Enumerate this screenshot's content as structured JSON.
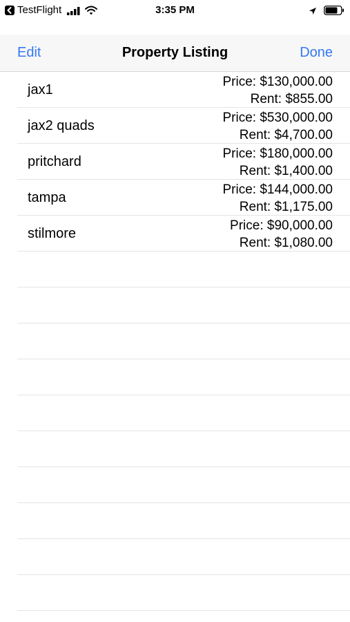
{
  "status_bar": {
    "back_app": "TestFlight",
    "time": "3:35 PM",
    "icons": [
      "back-arrow-icon",
      "signal-bars-icon",
      "wifi-icon",
      "location-arrow-icon",
      "battery-icon"
    ]
  },
  "nav": {
    "left_label": "Edit",
    "title": "Property Listing",
    "right_label": "Done",
    "accent_color": "#3478f6"
  },
  "properties": [
    {
      "name": "jax1",
      "price": "Price: $130,000.00",
      "rent": "Rent: $855.00"
    },
    {
      "name": "jax2 quads",
      "price": "Price: $530,000.00",
      "rent": "Rent: $4,700.00"
    },
    {
      "name": "pritchard",
      "price": "Price: $180,000.00",
      "rent": "Rent: $1,400.00"
    },
    {
      "name": "tampa",
      "price": "Price: $144,000.00",
      "rent": "Rent: $1,175.00"
    },
    {
      "name": "stilmore",
      "price": "Price: $90,000.00",
      "rent": "Rent: $1,080.00"
    }
  ]
}
